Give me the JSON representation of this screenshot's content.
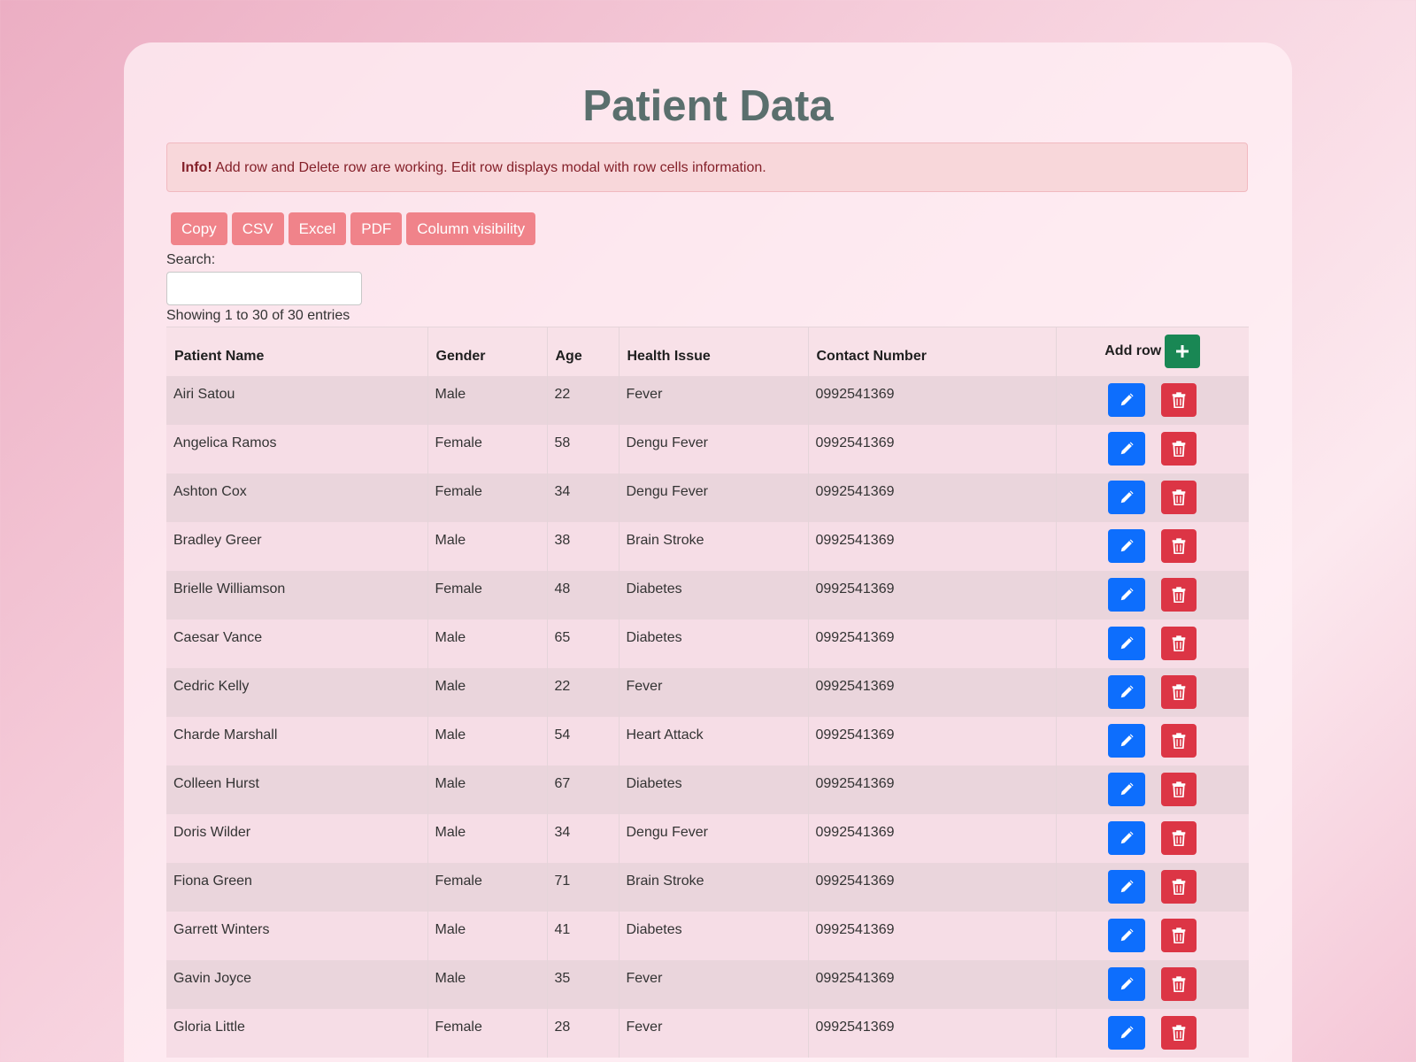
{
  "page": {
    "title": "Patient Data"
  },
  "alert": {
    "strong": "Info!",
    "message": " Add row and Delete row are working. Edit row displays modal with row cells information."
  },
  "toolbar": {
    "buttons": [
      "Copy",
      "CSV",
      "Excel",
      "PDF",
      "Column visibility"
    ]
  },
  "search": {
    "label": "Search:",
    "value": ""
  },
  "table_info": "Showing 1 to 30 of 30 entries",
  "table": {
    "columns": [
      "Patient Name",
      "Gender",
      "Age",
      "Health Issue",
      "Contact Number"
    ],
    "add_row_label": "Add row",
    "rows": [
      [
        "Airi Satou",
        "Male",
        "22",
        "Fever",
        "0992541369"
      ],
      [
        "Angelica Ramos",
        "Female",
        "58",
        "Dengu Fever",
        "0992541369"
      ],
      [
        "Ashton Cox",
        "Female",
        "34",
        "Dengu Fever",
        "0992541369"
      ],
      [
        "Bradley Greer",
        "Male",
        "38",
        "Brain Stroke",
        "0992541369"
      ],
      [
        "Brielle Williamson",
        "Female",
        "48",
        "Diabetes",
        "0992541369"
      ],
      [
        "Caesar Vance",
        "Male",
        "65",
        "Diabetes",
        "0992541369"
      ],
      [
        "Cedric Kelly",
        "Male",
        "22",
        "Fever",
        "0992541369"
      ],
      [
        "Charde Marshall",
        "Male",
        "54",
        "Heart Attack",
        "0992541369"
      ],
      [
        "Colleen Hurst",
        "Male",
        "67",
        "Diabetes",
        "0992541369"
      ],
      [
        "Doris Wilder",
        "Male",
        "34",
        "Dengu Fever",
        "0992541369"
      ],
      [
        "Fiona Green",
        "Female",
        "71",
        "Brain Stroke",
        "0992541369"
      ],
      [
        "Garrett Winters",
        "Male",
        "41",
        "Diabetes",
        "0992541369"
      ],
      [
        "Gavin Joyce",
        "Male",
        "35",
        "Fever",
        "0992541369"
      ],
      [
        "Gloria Little",
        "Female",
        "28",
        "Fever",
        "0992541369"
      ]
    ]
  },
  "icons": {
    "add": "plus-icon",
    "edit": "pencil-icon",
    "delete": "trash-icon"
  },
  "colors": {
    "title": "#5a6f6d",
    "toolbar_button": "#f0838a",
    "add_button": "#198754",
    "edit_button": "#0d6efd",
    "delete_button": "#dc3545",
    "alert_background": "#f8d7da",
    "alert_text": "#842029"
  }
}
